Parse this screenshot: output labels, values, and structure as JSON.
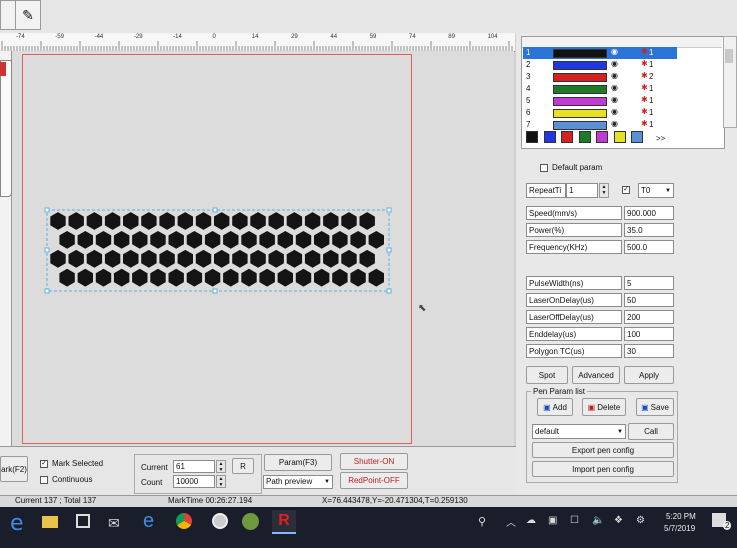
{
  "ruler": {
    "ticks": [
      "-74",
      "-59",
      "-44",
      "-29",
      "-14",
      "0",
      "14",
      "29",
      "44",
      "59",
      "74",
      "89",
      "104"
    ]
  },
  "pen_list": {
    "rows": [
      {
        "num": "1",
        "color": "#111111",
        "count": "1"
      },
      {
        "num": "2",
        "color": "#2036e0",
        "count": "1"
      },
      {
        "num": "3",
        "color": "#d42121",
        "count": "2"
      },
      {
        "num": "4",
        "color": "#1e7a25",
        "count": "1"
      },
      {
        "num": "5",
        "color": "#c23ad6",
        "count": "1"
      },
      {
        "num": "6",
        "color": "#e8e022",
        "count": "1"
      },
      {
        "num": "7",
        "color": "#5b8fd6",
        "count": "1"
      }
    ],
    "swatches": [
      "#111111",
      "#2036e0",
      "#d42121",
      "#1e7a25",
      "#c23ad6",
      "#e8e022",
      "#5b8fd6"
    ],
    "more": ">>"
  },
  "params": {
    "default_param": "Default param",
    "repeat_label": "RepeatTi",
    "repeat_value": "1",
    "t_select": "T0",
    "speed_label": "Speed(mm/s)",
    "speed_value": "900.000",
    "power_label": "Power(%)",
    "power_value": "35.0",
    "freq_label": "Frequency(KHz)",
    "freq_value": "500.0",
    "pulse_label": "PulseWidth(ns)",
    "pulse_value": "5",
    "onDelay_label": "LaserOnDelay(us)",
    "onDelay_value": "50",
    "offDelay_label": "LaserOffDelay(us)",
    "offDelay_value": "200",
    "endDelay_label": "Enddelay(us)",
    "endDelay_value": "100",
    "polygon_label": "Polygon TC(us)",
    "polygon_value": "30",
    "spot": "Spot",
    "advanced": "Advanced",
    "apply": "Apply"
  },
  "pen_param_list": {
    "title": "Pen Param list",
    "add": "Add",
    "delete": "Delete",
    "save": "Save",
    "selected": "default",
    "call": "Call",
    "export": "Export pen config",
    "import": "Import pen config"
  },
  "bottom": {
    "mark_btn": "ark(F2)",
    "mark_selected": "Mark Selected",
    "continuous": "Continuous",
    "current_label": "Current",
    "current_value": "61",
    "count_label": "Count",
    "count_value": "10000",
    "r_btn": "R",
    "param_btn": "Param(F3)",
    "path_preview": "Path preview",
    "shutter": "Shutter-ON",
    "redpoint": "RedPoint-OFF"
  },
  "status": {
    "current_total": "Current 137 ; Total 137",
    "mark_time": "MarkTime 00:26:27.194",
    "coords": "X=76.443478,Y=-20.471304,T=0.259130"
  },
  "taskbar": {
    "time": "5:20 PM",
    "date": "5/7/2019",
    "notification_count": "2"
  }
}
